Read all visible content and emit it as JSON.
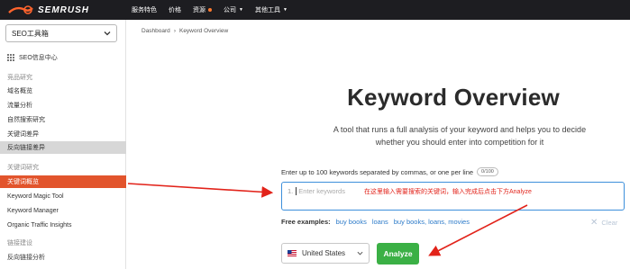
{
  "brand": {
    "name": "SEMRUSH",
    "color": "#ff642d"
  },
  "topnav": [
    {
      "label": "服务特色",
      "dot": false,
      "caret": false
    },
    {
      "label": "价格",
      "dot": false,
      "caret": false
    },
    {
      "label": "资源",
      "dot": true,
      "caret": false
    },
    {
      "label": "公司",
      "dot": false,
      "caret": true
    },
    {
      "label": "其他工具",
      "dot": false,
      "caret": true
    }
  ],
  "sidebar": {
    "toolkit_select": "SEO工具箱",
    "dashboard_label": "SEO信息中心",
    "sections": [
      {
        "heading": "竞品研究",
        "items": [
          "域名概览",
          "流量分析",
          "自然搜索研究",
          "关键词差异",
          "反向链接差异"
        ]
      },
      {
        "heading": "关键词研究",
        "items": [
          "关键词概览",
          "Keyword Magic Tool",
          "Keyword Manager",
          "Organic Traffic Insights"
        ]
      },
      {
        "heading": "链接建设",
        "items": [
          "反向链接分析"
        ]
      }
    ],
    "active_item": "关键词概览",
    "selected_item": "反向链接差异"
  },
  "breadcrumb": {
    "root": "Dashboard",
    "current": "Keyword Overview"
  },
  "hero": {
    "title": "Keyword Overview",
    "desc_line1": "A tool that runs a full analysis of your keyword and helps you to decide",
    "desc_line2": "whether you should enter into competition for it"
  },
  "keywords": {
    "label": "Enter up to 100 keywords separated by commas, or one per line",
    "count": "0/100",
    "line_number": "1.",
    "placeholder": "Enter keywords",
    "annotation": "在这里输入需要搜索的关键词，输入完成后点击下方Analyze"
  },
  "free_examples": {
    "label": "Free examples:",
    "links": [
      "buy books",
      "loans",
      "buy books, loans, movies"
    ],
    "clear": "Clear"
  },
  "database": {
    "country": "United States"
  },
  "analyze_button": "Analyze",
  "colors": {
    "accent": "#e2542c",
    "analyze": "#3bb045",
    "link": "#2d7bc9",
    "annotation": "#e2231a"
  }
}
